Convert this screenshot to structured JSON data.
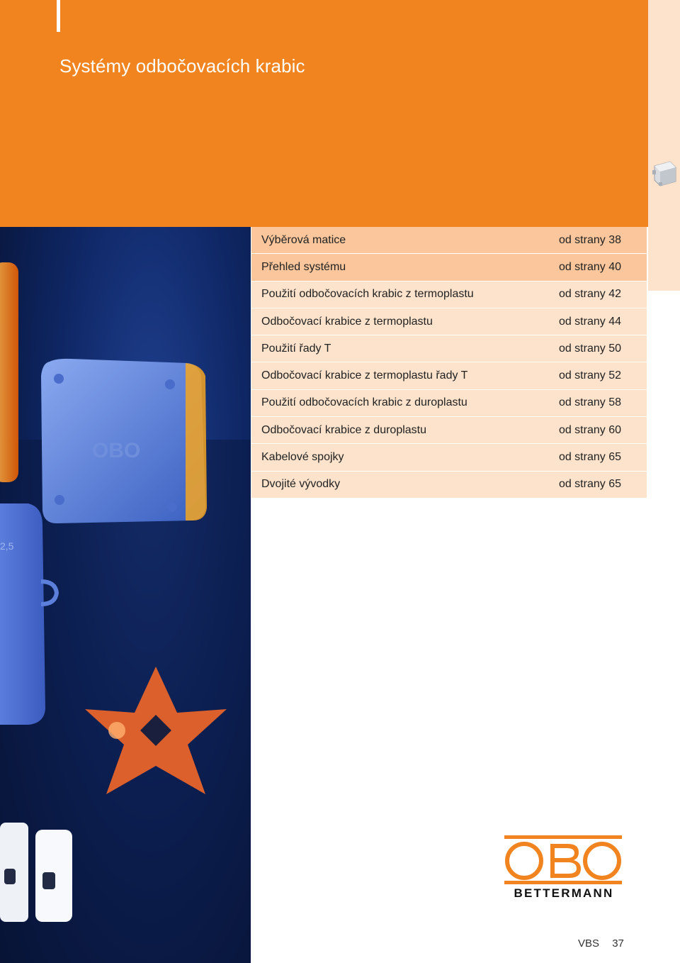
{
  "header": {
    "title": "Systémy odbočovacích krabic"
  },
  "toc": [
    {
      "label": "Výběrová matice",
      "page": "od strany 38",
      "tone": "dark"
    },
    {
      "label": "Přehled systému",
      "page": "od strany 40",
      "tone": "dark"
    },
    {
      "label": "Použití odbočovacích krabic z termoplastu",
      "page": "od strany 42",
      "tone": "light"
    },
    {
      "label": "Odbočovací krabice z termoplastu",
      "page": "od strany 44",
      "tone": "light"
    },
    {
      "label": "Použití řady T",
      "page": "od strany 50",
      "tone": "light"
    },
    {
      "label": "Odbočovací krabice z termoplastu řady T",
      "page": "od strany 52",
      "tone": "light"
    },
    {
      "label": "Použití odbočovacích krabic z duroplastu",
      "page": "od strany 58",
      "tone": "light"
    },
    {
      "label": "Odbočovací krabice z duroplastu",
      "page": "od strany 60",
      "tone": "light"
    },
    {
      "label": "Kabelové spojky",
      "page": "od strany 65",
      "tone": "light"
    },
    {
      "label": "Dvojité vývodky",
      "page": "od strany 65",
      "tone": "light"
    }
  ],
  "logo": {
    "brand": "OBO",
    "subtitle": "BETTERMANN"
  },
  "footer": {
    "section": "VBS",
    "page_number": "37"
  },
  "colors": {
    "accent": "#f2841f",
    "row_dark": "#fbc69b",
    "row_light": "#fde3cc"
  },
  "photo": {
    "box_marking": "OBO",
    "box_rating": "2,5"
  }
}
